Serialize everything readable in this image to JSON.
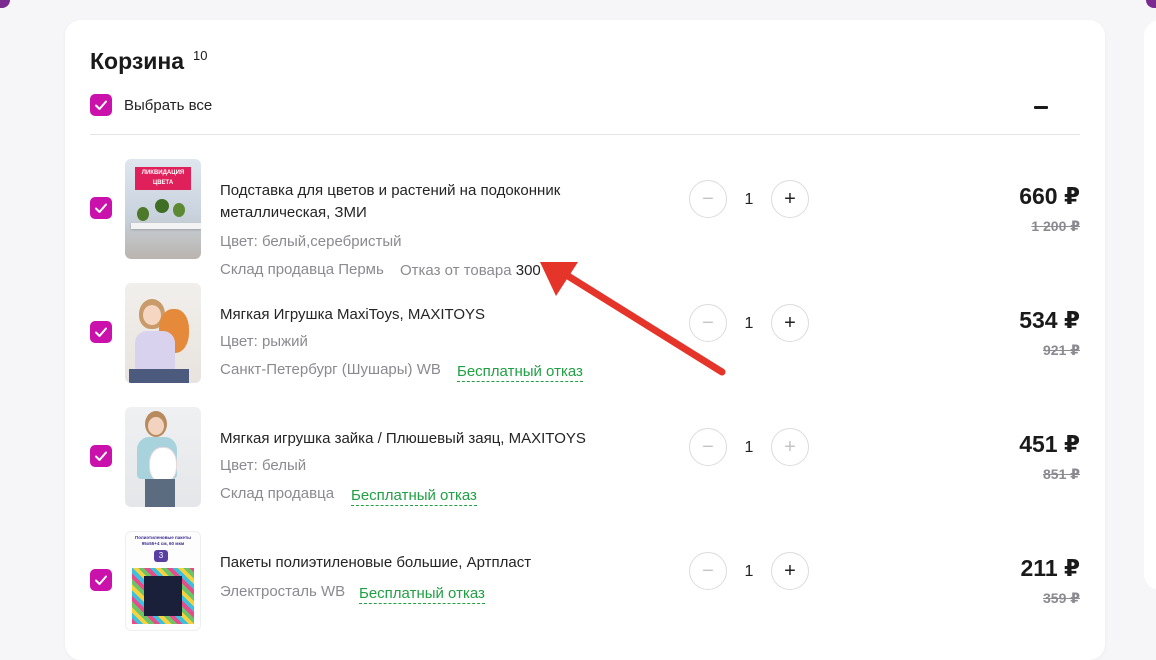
{
  "cart": {
    "title": "Корзина",
    "count": "10",
    "select_all_label": "Выбрать все",
    "accent_color": "#cb11ab",
    "link_color": "#20a044"
  },
  "items": [
    {
      "name": "Подставка для цветов и растений на подоконник металлическая, ЗМИ",
      "thumb_text": "ЛИКВИДАЦИЯ ЦВЕТА",
      "color": "Цвет: белый,серебристый",
      "warehouse": "Склад продавца Пермь",
      "refusal_label": "Отказ от товара",
      "refusal_price": "300 ₽",
      "free_refusal": "",
      "quantity": "1",
      "price": "660 ₽",
      "old_price": "1 200 ₽"
    },
    {
      "name": "Мягкая Игрушка MaxiToys, MAXITOYS",
      "color": "Цвет: рыжий",
      "warehouse": "Санкт-Петербург (Шушары) WB",
      "free_refusal": "Бесплатный отказ",
      "quantity": "1",
      "price": "534 ₽",
      "old_price": "921 ₽"
    },
    {
      "name": "Мягкая игрушка зайка / Плюшевый заяц, MAXITOYS",
      "color": "Цвет: белый",
      "warehouse": "Склад продавца",
      "free_refusal": "Бесплатный отказ",
      "quantity": "1",
      "price": "451 ₽",
      "old_price": "851 ₽"
    },
    {
      "name": "Пакеты полиэтиленовые большие, Артпласт",
      "thumb_text": "Полиэтиленовые пакеты 95х55+4 см, 60 мкм",
      "thumb_badge": "3",
      "color": "",
      "warehouse": "Электросталь WB",
      "free_refusal": "Бесплатный отказ",
      "quantity": "1",
      "price": "211 ₽",
      "old_price": "359 ₽"
    }
  ]
}
